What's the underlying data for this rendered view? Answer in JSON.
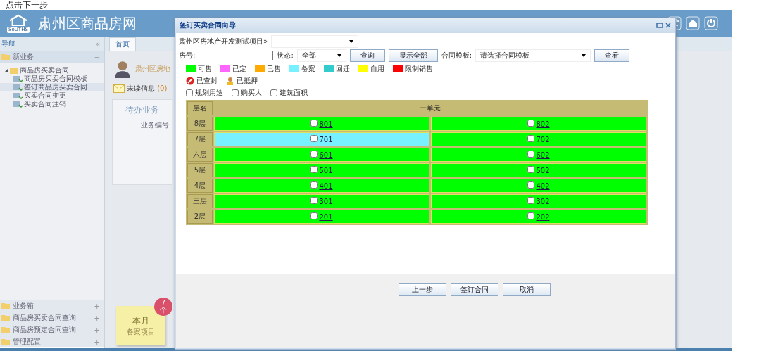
{
  "caption": "点击下一步",
  "header": {
    "title": "肃州区商品房网",
    "logo_text": "SoUTHS"
  },
  "sidebar": {
    "title": "导航",
    "collapse": "«",
    "sections_top": [
      {
        "label": "新业务",
        "toggle": "−",
        "expanded": true,
        "tree": [
          {
            "label": "商品房买卖合同",
            "expanded": true,
            "selected": false,
            "children": [
              {
                "label": "商品房买卖合同模板",
                "selected": false
              },
              {
                "label": "签订商品房买卖合同",
                "selected": true
              },
              {
                "label": "买卖合同变更",
                "selected": false
              },
              {
                "label": "买卖合同注销",
                "selected": false
              }
            ]
          }
        ]
      }
    ],
    "sections_bottom": [
      {
        "label": "业务箱",
        "toggle": "+"
      },
      {
        "label": "商品房买卖合同查询",
        "toggle": "+"
      },
      {
        "label": "商品房预定合同查询",
        "toggle": "+"
      },
      {
        "label": "管理配置",
        "toggle": "+"
      }
    ]
  },
  "main": {
    "tabs": [
      {
        "label": "首页",
        "selected": true
      }
    ],
    "user_name": "肃州区房地",
    "unread": "未读信息",
    "unread_count": "(0)",
    "todo_title": "待办业务",
    "todo_column": "业务编号",
    "note": {
      "title": "本月",
      "subtitle": "备案项目",
      "badge_number": "7",
      "badge_unit": "个"
    }
  },
  "dialog": {
    "title": "签订买卖合同向导",
    "project": "肃州区房地产开发测试项目»",
    "room_label": "房号:",
    "status_label": "状态:",
    "status_value": "全部",
    "query": "查询",
    "show_all": "显示全部",
    "template_label": "合同模板:",
    "template_value": "请选择合同模板",
    "view": "查看",
    "legend": [
      {
        "label": "可售",
        "color": "#00ff00"
      },
      {
        "label": "已定",
        "color": "#ff66ff"
      },
      {
        "label": "已售",
        "color": "#ffaa00"
      },
      {
        "label": "备案",
        "color": "#77f0ff"
      },
      {
        "label": "回迁",
        "color": "#33cccc"
      },
      {
        "label": "自用",
        "color": "#ffff00"
      },
      {
        "label": "限制销售",
        "color": "#ff0000"
      }
    ],
    "markers": [
      {
        "kind": "sealed",
        "label": "已查封"
      },
      {
        "kind": "mortgaged",
        "label": "已抵押"
      }
    ],
    "options": [
      {
        "label": "规划用途",
        "checked": false
      },
      {
        "label": "购买人",
        "checked": false
      },
      {
        "label": "建筑面积",
        "checked": false
      }
    ],
    "table": {
      "floor_header": "层名",
      "unit_header": "一单元",
      "rows": [
        {
          "floor": "8层",
          "cells": [
            {
              "room": "801",
              "color": "#00ff00",
              "checked": false
            },
            {
              "room": "802",
              "color": "#00ff00",
              "checked": false
            }
          ]
        },
        {
          "floor": "7层",
          "cells": [
            {
              "room": "701",
              "color": "#77f0ff",
              "checked": false
            },
            {
              "room": "702",
              "color": "#00ff00",
              "checked": false
            }
          ]
        },
        {
          "floor": "六层",
          "cells": [
            {
              "room": "601",
              "color": "#00ff00",
              "checked": false
            },
            {
              "room": "602",
              "color": "#00ff00",
              "checked": false
            }
          ]
        },
        {
          "floor": "5层",
          "cells": [
            {
              "room": "501",
              "color": "#00ff00",
              "checked": false
            },
            {
              "room": "502",
              "color": "#00ff00",
              "checked": false
            }
          ]
        },
        {
          "floor": "4层",
          "cells": [
            {
              "room": "401",
              "color": "#00ff00",
              "checked": false
            },
            {
              "room": "402",
              "color": "#00ff00",
              "checked": false
            }
          ]
        },
        {
          "floor": "三层",
          "cells": [
            {
              "room": "301",
              "color": "#00ff00",
              "checked": false
            },
            {
              "room": "302",
              "color": "#00ff00",
              "checked": false
            }
          ]
        },
        {
          "floor": "2层",
          "cells": [
            {
              "room": "201",
              "color": "#00ff00",
              "checked": false
            },
            {
              "room": "202",
              "color": "#00ff00",
              "checked": false
            }
          ]
        }
      ]
    },
    "buttons": [
      "上一步",
      "签订合同",
      "取消"
    ]
  }
}
